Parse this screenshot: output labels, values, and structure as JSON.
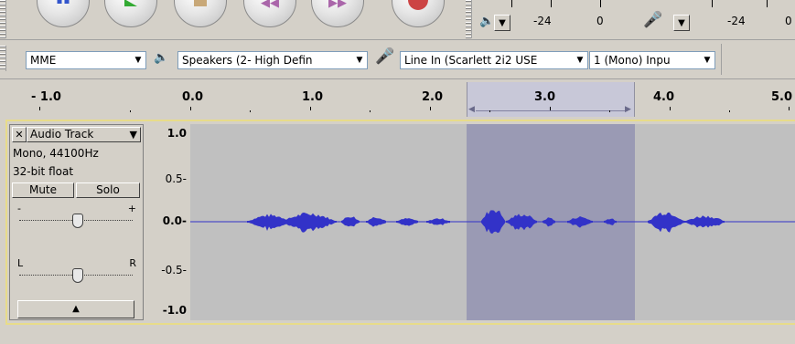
{
  "meters": {
    "play_db_left": "-24",
    "play_db_right": "0",
    "rec_db_left": "-24",
    "rec_db_right": "0"
  },
  "devices": {
    "host": "MME",
    "output": "Speakers (2- High Defin",
    "input": "Line In (Scarlett 2i2 USE",
    "channels": "1 (Mono) Inpu"
  },
  "ruler": {
    "labels": [
      "- 1.0",
      "0.0",
      "1.0",
      "2.0",
      "3.0",
      "4.0",
      "5.0"
    ]
  },
  "track": {
    "name": "Audio Track",
    "info_line1": "Mono, 44100Hz",
    "info_line2": "32-bit float",
    "mute_label": "Mute",
    "solo_label": "Solo",
    "gain_minus": "-",
    "gain_plus": "+",
    "pan_left": "L",
    "pan_right": "R",
    "collapse_glyph": "▲",
    "close_glyph": "✕",
    "menu_glyph": "▼"
  },
  "scale": {
    "top": "1.0",
    "upper": "0.5-",
    "mid": "0.0-",
    "lower": "-0.5-",
    "bottom": "-1.0"
  },
  "colors": {
    "waveform": "#3232c8",
    "selection": "#9a9ab4",
    "track_bg": "#c0c0c0",
    "track_selected_border": "#f0e68c"
  },
  "icons": {
    "speaker": "speaker-icon",
    "microphone": "microphone-icon"
  }
}
